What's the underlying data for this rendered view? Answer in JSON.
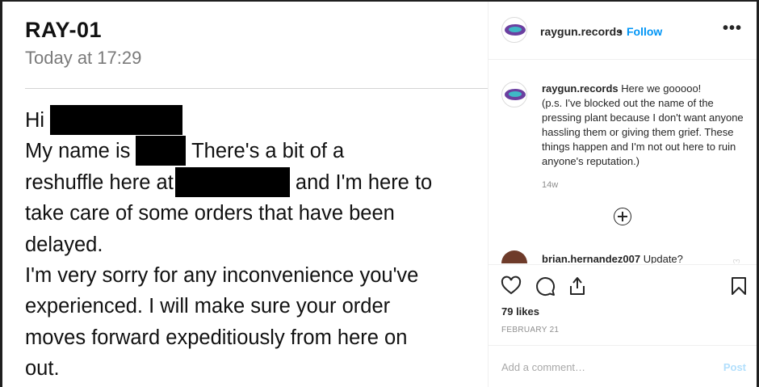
{
  "message": {
    "title": "RAY-01",
    "date": "Today at 17:29",
    "lines": [
      {
        "a": "Hi",
        "b": "",
        "c": ""
      },
      {
        "a": "My name is",
        "b": "There's a bit of a",
        "c": ""
      },
      {
        "a": "reshuffle here at",
        "b": "and I'm here to",
        "c": ""
      },
      {
        "a": "take care of some orders that have been",
        "b": "",
        "c": ""
      },
      {
        "a": "delayed.",
        "b": "",
        "c": ""
      },
      {
        "a": "I'm very sorry for any inconvenience you've",
        "b": "",
        "c": ""
      },
      {
        "a": "experienced. I will make sure your order",
        "b": "",
        "c": ""
      },
      {
        "a": "moves forward expeditiously from here on",
        "b": "",
        "c": ""
      },
      {
        "a": "out.",
        "b": "",
        "c": ""
      }
    ]
  },
  "post": {
    "username": "raygun.records",
    "dot": "•",
    "follow": "Follow",
    "more": "•••",
    "caption_user": "raygun.records",
    "caption_text": "Here we gooooo!",
    "caption_note": "(p.s. I've blocked out the name of the pressing plant because I don't want anyone hassling them or giving them grief. These things happen and I'm not out here to ruin anyone's reputation.)",
    "age": "14w",
    "reply_user": "brian.hernandez007",
    "reply_text": "Update?",
    "likes": "79 likes",
    "date": "FEBRUARY 21",
    "add_comment_placeholder": "Add a comment…",
    "post_label": "Post"
  },
  "icons": [
    "like-icon",
    "comment-icon",
    "share-icon",
    "bookmark-icon",
    "load-more-icon",
    "more-options-icon"
  ],
  "colors": {
    "link": "#0095f6",
    "muted": "#8e8e8e",
    "post_disabled": "#b2dffc"
  }
}
